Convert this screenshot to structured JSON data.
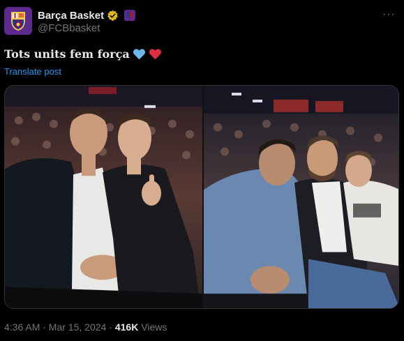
{
  "post": {
    "author": {
      "display_name": "Barça Basket",
      "handle": "@FCBbasket",
      "verified_icon": "verified-gold-badge-icon",
      "affiliation_icon": "fcb-affiliation-icon"
    },
    "more_label": "···",
    "text": "Tots units fem força",
    "emojis": [
      "blue-heart-icon",
      "red-heart-icon"
    ],
    "translate_label": "Translate post",
    "media": [
      {
        "name": "photo-left"
      },
      {
        "name": "photo-right"
      }
    ],
    "timestamp": "4:36 AM · Mar 15, 2024 ·",
    "views_count": "416K",
    "views_label": "Views"
  },
  "colors": {
    "background": "#000000",
    "text_primary": "#e7e9ea",
    "text_secondary": "#71767b",
    "link": "#1d9bf0",
    "brand": "#5b2a8c",
    "verified_gold": "#e2b719"
  }
}
